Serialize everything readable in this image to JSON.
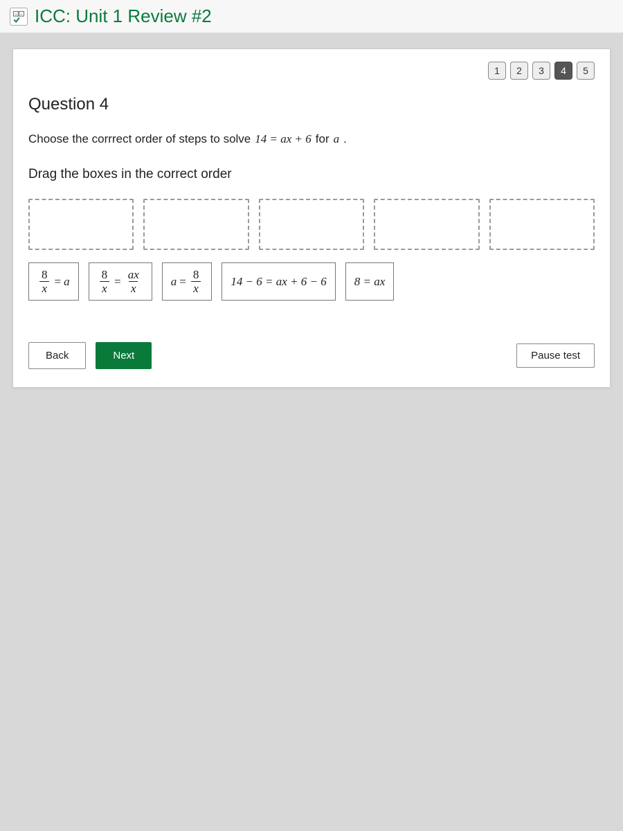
{
  "header": {
    "title": "ICC: Unit 1 Review #2"
  },
  "nav": {
    "items": [
      "1",
      "2",
      "3",
      "4",
      "5"
    ],
    "active_index": 3
  },
  "question": {
    "title": "Question 4",
    "prompt_before": "Choose the corrrect order of steps to solve ",
    "prompt_math": "14 = ax + 6",
    "prompt_after_1": " for ",
    "prompt_var": "a",
    "prompt_after_2": ".",
    "drag_instruction": "Drag the boxes in the correct order",
    "drop_slot_count": 5,
    "drag_items": [
      {
        "type": "frac_eq",
        "left_num": "8",
        "left_den": "x",
        "eq": "=",
        "right": "a"
      },
      {
        "type": "frac_frac",
        "left_num": "8",
        "left_den": "x",
        "eq": "=",
        "right_num": "ax",
        "right_den": "x"
      },
      {
        "type": "eq_frac",
        "left": "a",
        "eq": "=",
        "right_num": "8",
        "right_den": "x"
      },
      {
        "type": "plain",
        "text": "14 − 6 = ax + 6 − 6"
      },
      {
        "type": "plain",
        "text": "8 = ax"
      }
    ]
  },
  "buttons": {
    "back": "Back",
    "next": "Next",
    "pause": "Pause test"
  }
}
